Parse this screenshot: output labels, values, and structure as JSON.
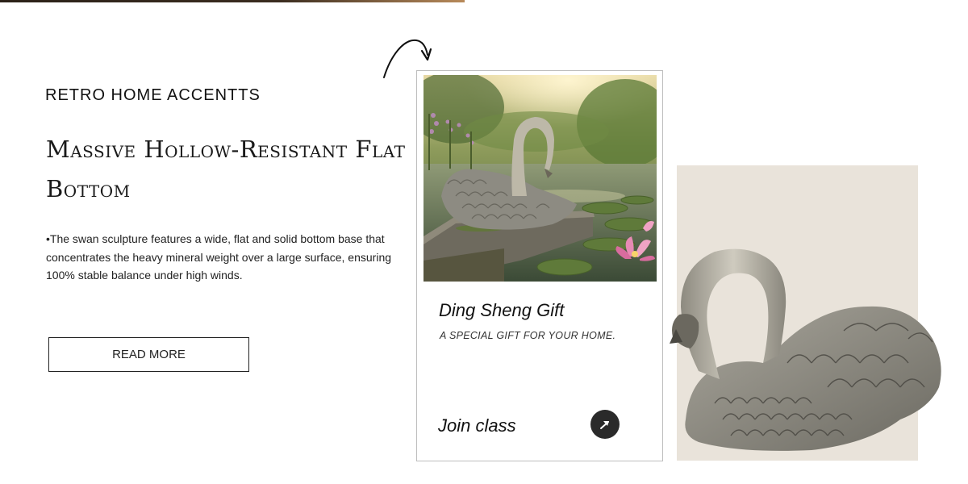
{
  "hero": {
    "eyebrow": "RETRO HOME ACCENTTS",
    "headline": "Massive Hollow-Resistant Flat Bottom",
    "body": "•The swan sculpture features a wide, flat and solid bottom base that concentrates the heavy mineral weight over a large surface, ensuring 100% stable balance under high winds.",
    "read_more_label": "READ MORE"
  },
  "card": {
    "title": "Ding Sheng Gift",
    "subtitle": "A SPECIAL GIFT FOR YOUR HOME.",
    "cta_label": "Join class",
    "cta_icon": "arrow-up-right-icon"
  },
  "colors": {
    "accent_dark": "#2a2a2a",
    "panel_beige": "#e9e3da",
    "text": "#111111"
  }
}
